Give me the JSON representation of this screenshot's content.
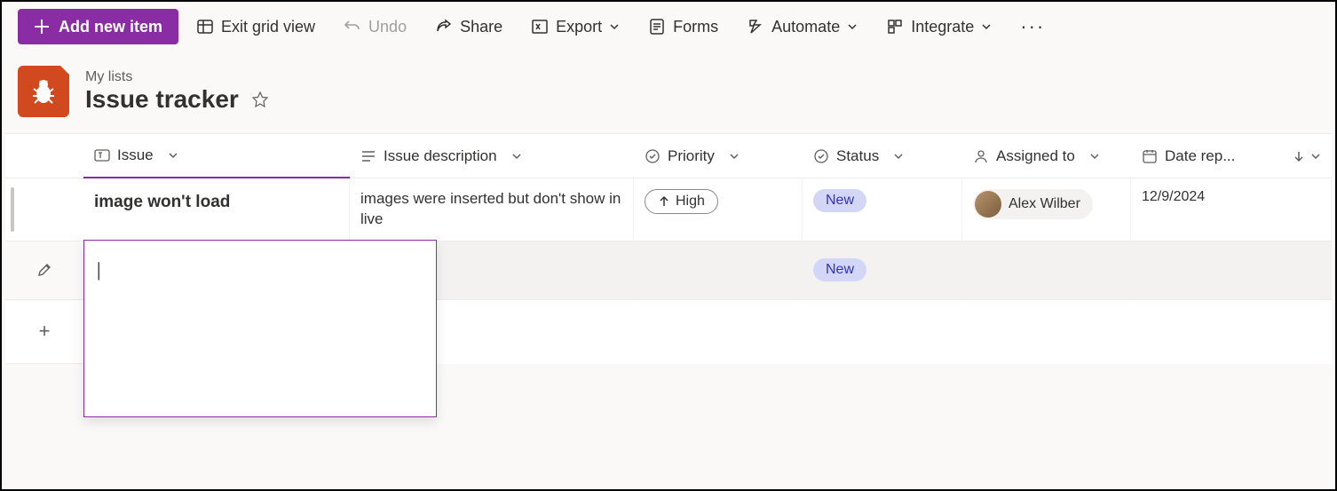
{
  "toolbar": {
    "add_new_item": "Add new item",
    "exit_grid_view": "Exit grid view",
    "undo": "Undo",
    "share": "Share",
    "export": "Export",
    "forms": "Forms",
    "automate": "Automate",
    "integrate": "Integrate"
  },
  "header": {
    "breadcrumb": "My lists",
    "title": "Issue tracker"
  },
  "columns": {
    "issue": "Issue",
    "description": "Issue description",
    "priority": "Priority",
    "status": "Status",
    "assigned_to": "Assigned to",
    "date_reported": "Date rep..."
  },
  "rows": [
    {
      "issue": "image won't load",
      "description": "images were inserted but don't show in live",
      "priority": "High",
      "status": "New",
      "assigned_to": "Alex Wilber",
      "date_reported": "12/9/2024"
    }
  ],
  "editing_row": {
    "status": "New",
    "input_value": "|"
  },
  "colors": {
    "accent": "#8a2da5",
    "list_icon": "#d14a1f",
    "status_bg": "#d4d6f7",
    "status_fg": "#3032c1"
  }
}
